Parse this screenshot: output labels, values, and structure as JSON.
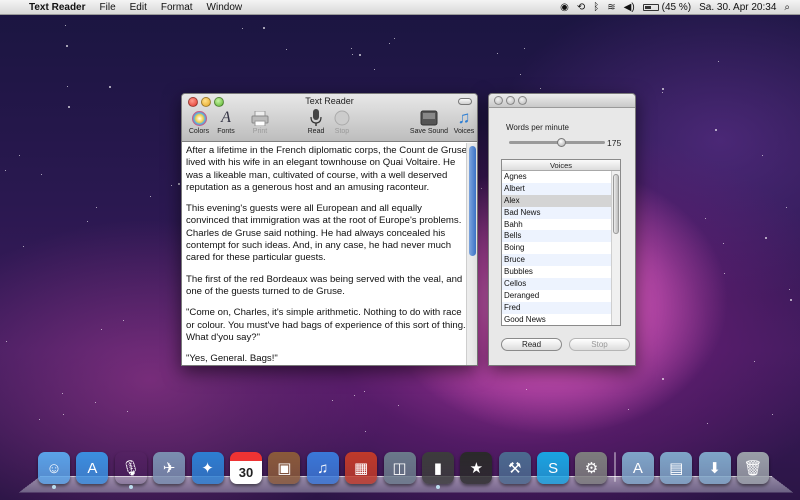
{
  "menubar": {
    "app_name": "Text Reader",
    "menus": [
      "File",
      "Edit",
      "Format",
      "Window"
    ],
    "battery": "(45 %)",
    "datetime": "Sa. 30. Apr  20:34"
  },
  "window": {
    "title": "Text Reader",
    "toolbar": {
      "colors": "Colors",
      "fonts": "Fonts",
      "print": "Print",
      "read": "Read",
      "stop": "Stop",
      "save_sound": "Save Sound",
      "voices": "Voices"
    },
    "paragraphs": [
      "After a lifetime in the French diplomatic corps, the Count de Gruse lived with his wife in an elegant townhouse on Quai Voltaire. He was a likeable man, cultivated of course, with a well deserved reputation as a generous host and an amusing raconteur.",
      "This evening's guests were all European and all equally convinced that immigration was at the root of Europe's problems. Charles de Gruse said nothing. He had always concealed his contempt for such ideas. And, in any case, he had never much cared for these particular guests.",
      "The first of the red Bordeaux was being served with the veal, and one of the guests turned to de Gruse.",
      "\"Come on, Charles, it's simple arithmetic. Nothing to do with race or colour. You must've had bags of experience of this sort of thing. What d'you say?\"",
      "\"Yes, General. Bags!\""
    ]
  },
  "panel": {
    "wpm_label": "Words per minute",
    "wpm_value": "175",
    "wpm_slider_fraction": 0.55,
    "voices_header": "Voices",
    "voices": [
      "Agnes",
      "Albert",
      "Alex",
      "Bad News",
      "Bahh",
      "Bells",
      "Boing",
      "Bruce",
      "Bubbles",
      "Cellos",
      "Deranged",
      "Fred",
      "Good News"
    ],
    "selected_voice": "Alex",
    "read_button": "Read",
    "stop_button": "Stop"
  },
  "dock": {
    "icons": [
      "finder-icon",
      "app-store-icon",
      "microphone-icon",
      "mail-icon",
      "safari-icon",
      "calendar-icon",
      "photo-booth-icon",
      "itunes-icon",
      "photo-icon",
      "preview-icon",
      "battery-app-icon",
      "imovie-icon",
      "xcode-icon",
      "skype-icon",
      "system-preferences-icon",
      "applications-folder-icon",
      "documents-folder-icon",
      "downloads-folder-icon",
      "trash-icon"
    ],
    "calendar_day": "30"
  },
  "colors": {
    "selection": "#3f78cf"
  }
}
